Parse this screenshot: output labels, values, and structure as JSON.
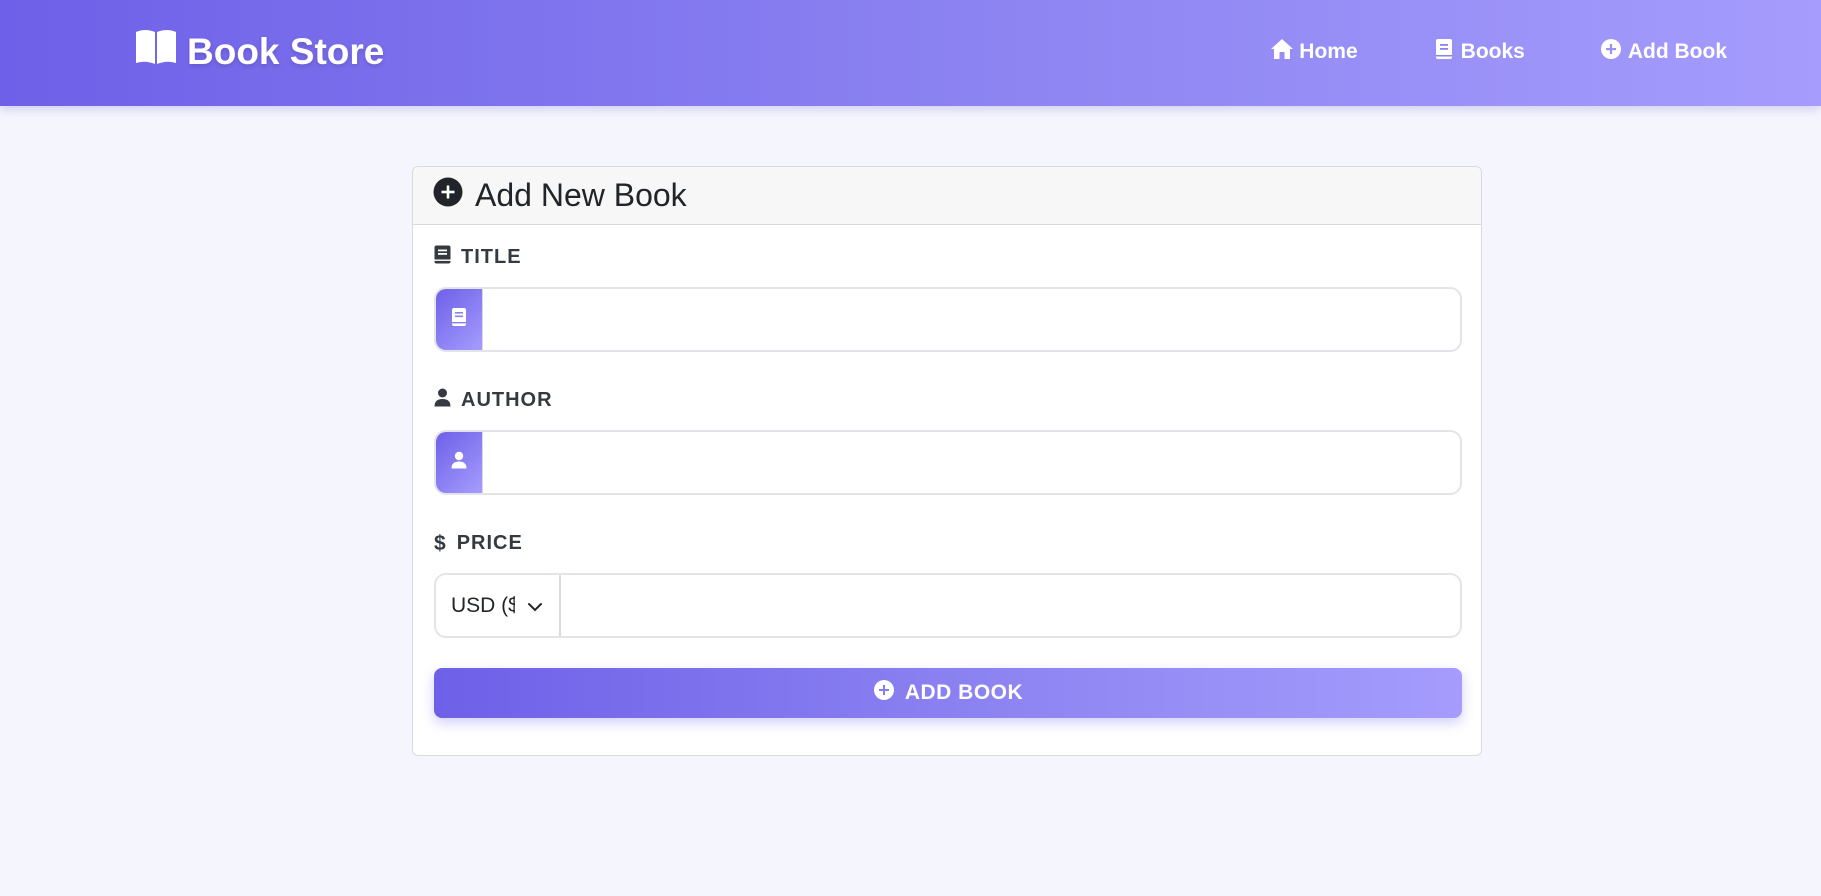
{
  "navbar": {
    "brand": "Book Store",
    "brand_icon": "open-book-icon",
    "links": [
      {
        "label": "Home",
        "icon": "home-icon"
      },
      {
        "label": "Books",
        "icon": "book-icon"
      },
      {
        "label": "Add Book",
        "icon": "plus-circle-icon"
      }
    ]
  },
  "form": {
    "header": "Add New Book",
    "title_label": "TITLE",
    "title_value": "",
    "author_label": "AUTHOR",
    "author_value": "",
    "price_label": "PRICE",
    "price_value": "",
    "currency_selected": "USD ($",
    "submit_label": "ADD BOOK"
  },
  "colors": {
    "accent_start": "#6e60e8",
    "accent_end": "#a59cfd",
    "background": "#f5f6fd"
  }
}
